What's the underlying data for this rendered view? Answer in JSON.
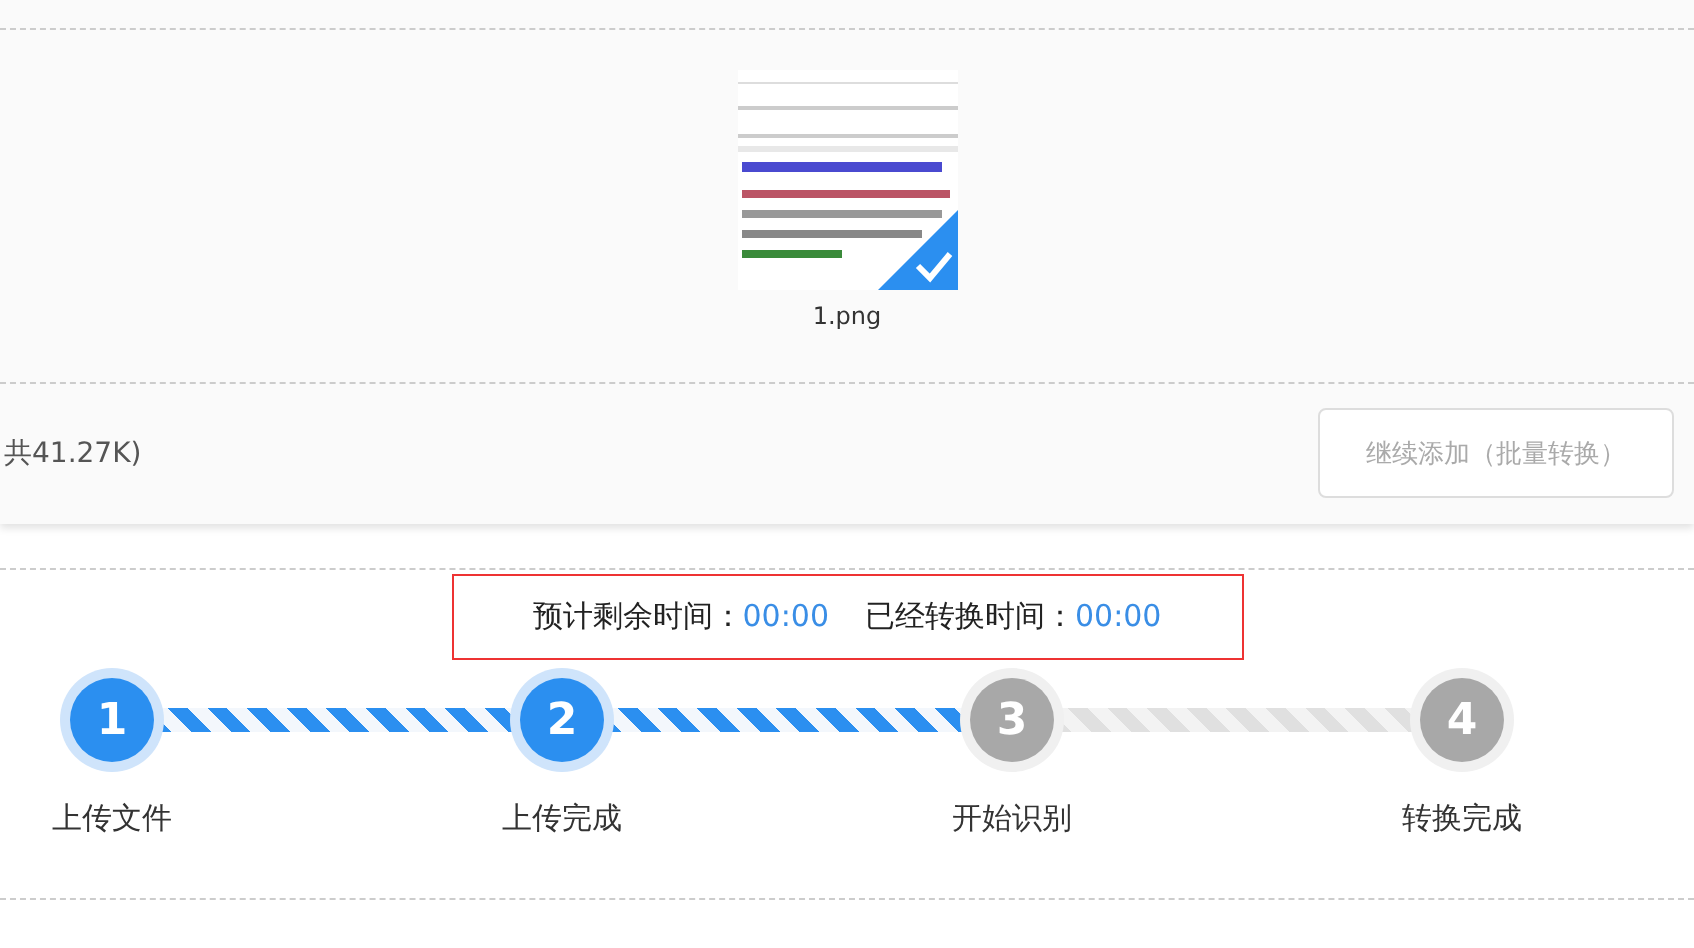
{
  "files": [
    {
      "name": "1.png",
      "selected": true,
      "kind": "picture"
    }
  ],
  "total_size": "共41.27K)",
  "add_button": {
    "label": "继续添加（批量转换）",
    "disabled": true
  },
  "timer": {
    "remaining_label": "预计剩余时间：",
    "remaining": "00:00",
    "elapsed_label": "已经转换时间：",
    "elapsed": "00:00"
  },
  "steps": [
    {
      "number": "1",
      "label": "上传文件",
      "active": true
    },
    {
      "number": "2",
      "label": "上传完成",
      "active": true
    },
    {
      "number": "3",
      "label": "开始识别",
      "active": false
    },
    {
      "number": "4",
      "label": "转换完成",
      "active": false
    }
  ]
}
